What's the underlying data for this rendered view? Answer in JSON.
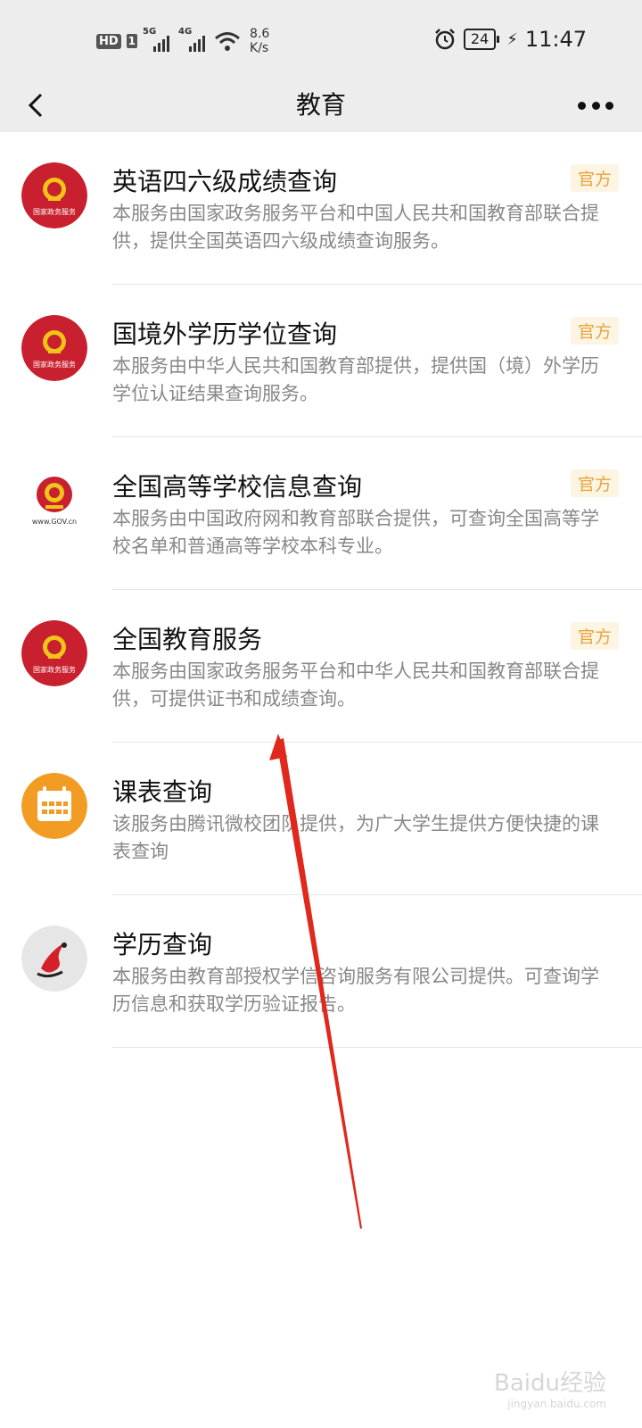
{
  "status_bar": {
    "hd": "HD",
    "sim": "1",
    "net1": "5G",
    "net2": "4G",
    "speed_value": "8.6",
    "speed_unit": "K/s",
    "battery": "24",
    "time": "11:47"
  },
  "nav": {
    "title": "教育",
    "back_icon": "chevron-left-icon",
    "more_icon": "more-dots-icon"
  },
  "services": [
    {
      "title": "英语四六级成绩查询",
      "description": "本服务由国家政务服务平台和中国人民共和国教育部联合提供，提供全国英语四六级成绩查询服务。",
      "badge": "官方",
      "logo_type": "gov-service",
      "logo_text": "国家政务服务"
    },
    {
      "title": "国境外学历学位查询",
      "description": "本服务由中华人民共和国教育部提供，提供国（境）外学历学位认证结果查询服务。",
      "badge": "官方",
      "logo_type": "gov-service",
      "logo_text": "国家政务服务"
    },
    {
      "title": "全国高等学校信息查询",
      "description": "本服务由中国政府网和教育部联合提供，可查询全国高等学校名单和普通高等学校本科专业。",
      "badge": "官方",
      "logo_type": "gov-cn",
      "logo_text": "www.GOV.cn"
    },
    {
      "title": "全国教育服务",
      "description": "本服务由国家政务服务平台和中华人民共和国教育部联合提供，可提供证书和成绩查询。",
      "badge": "官方",
      "logo_type": "gov-service",
      "logo_text": "国家政务服务"
    },
    {
      "title": "课表查询",
      "description": "该服务由腾讯微校团队提供，为广大学生提供方便快捷的课表查询",
      "badge": "",
      "logo_type": "calendar",
      "logo_text": ""
    },
    {
      "title": "学历查询",
      "description": "本服务由教育部授权学信咨询服务有限公司提供。可查询学历信息和获取学历验证报告。",
      "badge": "",
      "logo_type": "chsi",
      "logo_text": ""
    }
  ],
  "watermark": {
    "text": "Baidu经验",
    "sub": "jingyan.baidu.com"
  },
  "colors": {
    "header_bg": "#ededed",
    "gov_red": "#c8202e",
    "badge_text": "#e8a33a",
    "badge_bg": "#fdf5e4",
    "calendar_orange": "#f39c23",
    "annotation_arrow": "#e0281c"
  }
}
